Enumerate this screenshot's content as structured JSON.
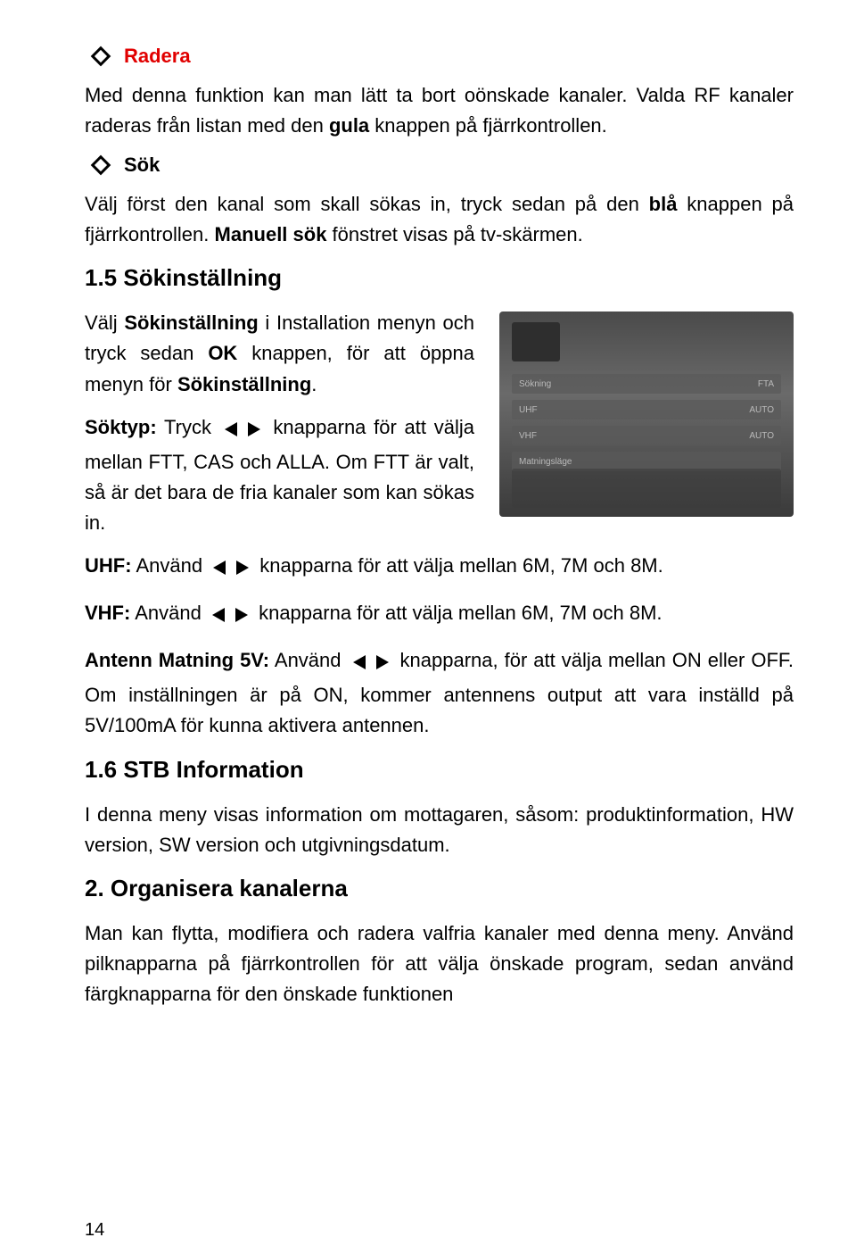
{
  "bullets": {
    "radera_title": "Radera",
    "sok_title": "Sök"
  },
  "radera_text_1": "Med denna funktion kan man lätt ta bort oönskade kanaler. Valda RF kanaler raderas från listan med den ",
  "radera_bold": "gula",
  "radera_text_2": " knappen på fjärrkontrollen.",
  "sok_text_1a": "Välj först den kanal som skall sökas in, tryck sedan på den ",
  "sok_text_1b_bold": "blå",
  "sok_text_1c": " knappen på fjärrkontrollen. ",
  "sok_text_1d_bold": "Manuell sök",
  "sok_text_1e": " fönstret visas på tv-skärmen.",
  "section_15": "1.5 Sökinställning",
  "p15_a1": "Välj ",
  "p15_a2_bold": "Sökinställning",
  "p15_a3": " i Installation menyn och tryck sedan ",
  "p15_a4_bold": "OK",
  "p15_a5": " knappen, för att öppna menyn för ",
  "p15_a6_bold": "Sökinställning",
  "p15_a7": ".",
  "soktyp_bold": "Söktyp:",
  "soktyp_after": " Tryck ",
  "soktyp_tail": " knapparna för att välja mellan FTT, CAS och ALLA. Om FTT är valt, så är det bara de fria kanaler som kan sökas in.",
  "uhf_bold": "UHF:",
  "uhf_after": " Använd ",
  "uhf_tail": " knapparna för att välja mellan 6M, 7M och 8M.",
  "vhf_bold": "VHF:",
  "vhf_after": " Använd ",
  "vhf_tail": " knapparna för att välja mellan 6M, 7M och 8M.",
  "antenn_bold": "Antenn Matning 5V:",
  "antenn_after": " Använd ",
  "antenn_tail": " knapparna, för att välja mellan ON eller OFF. Om inställningen är på ON, kommer antennens output att vara inställd på 5V/100mA för kunna aktivera antennen.",
  "section_16": "1.6 STB Information",
  "p16_text": "I denna meny visas information om mottagaren, såsom: produktinformation, HW version, SW version och utgivningsdatum.",
  "section_2": "2. Organisera kanalerna",
  "p2_text": "Man kan flytta, modifiera och radera valfria kanaler med denna meny. Använd pilknapparna på fjärrkontrollen för att välja önskade program, sedan använd färgknapparna för den önskade funktionen",
  "page_number": "14",
  "screenshot_rows": [
    {
      "l": "Sökning",
      "r": "FTA"
    },
    {
      "l": "UHF",
      "r": "AUTO"
    },
    {
      "l": "VHF",
      "r": "AUTO"
    },
    {
      "l": "Matningsläge",
      "r": ""
    }
  ]
}
